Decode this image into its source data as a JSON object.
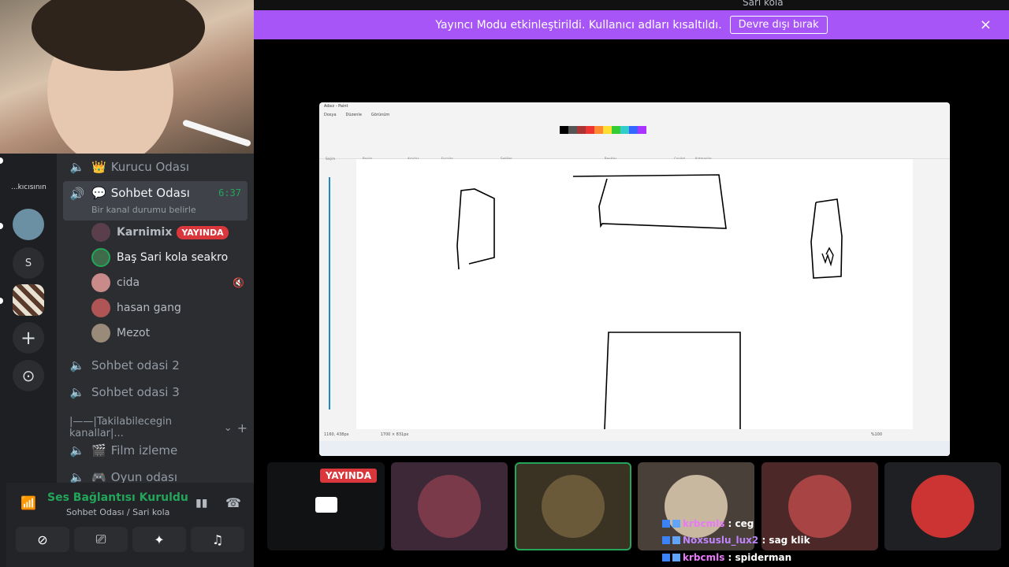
{
  "banner": {
    "text": "Yayıncı Modu etkinleştirildi. Kullanıcı adları kısaltıldı.",
    "button": "Devre dışı bırak",
    "close": "×"
  },
  "top_partial": {
    "name": "Sarı kola"
  },
  "rail": {
    "label_kicisinin": "...kıcısının",
    "server_s": "S",
    "add": "+",
    "explore": "⊙"
  },
  "channels": {
    "kurucu": "Kurucu Odası",
    "sohbet": "Sohbet Odası",
    "sohbet_time": "6:37",
    "sohbet_status": "Bir kanal durumu belirle",
    "sohbet2": "Sohbet odasi 2",
    "sohbet3": "Sohbet odasi 3",
    "takilabilecegin": "|——|Takilabilecegin kanallar|...",
    "film": "Film izleme",
    "oyun": "Oyun odası"
  },
  "users": [
    {
      "name": "Karnimix",
      "badge": "YAYINDA"
    },
    {
      "name": "Baş Sari kola seakro"
    },
    {
      "name": "cida"
    },
    {
      "name": "hasan gang"
    },
    {
      "name": "Mezot"
    }
  ],
  "voice": {
    "status": "Ses Bağlantısı Kuruldu",
    "channel": "Sohbet Odası / Sari kola"
  },
  "paint": {
    "title": "Adsız - Paint",
    "menu": [
      "Dosya",
      "Düzenle",
      "Görünüm"
    ],
    "sections": [
      "Seçim",
      "Resim",
      "Araçlar",
      "Fırçalar",
      "Şekiller",
      "Renkler",
      "Copilot",
      "Katmanlar"
    ],
    "status_pos": "1160, 438px",
    "status_size": "1700 × 831px",
    "zoom": "%100"
  },
  "tiles": {
    "live": "YAYINDA"
  },
  "chat": [
    {
      "user": "krbcmls",
      "msg": "ceg",
      "color": "#e879f9"
    },
    {
      "user": "Noxsuslu_lux2",
      "msg": "sag klik",
      "color": "#c084fc"
    },
    {
      "user": "krbcmls",
      "msg": "spiderman",
      "color": "#e879f9"
    }
  ],
  "colors": {
    "banner": "#a855f7",
    "live": "#da373c",
    "voice_green": "#23a55a"
  }
}
